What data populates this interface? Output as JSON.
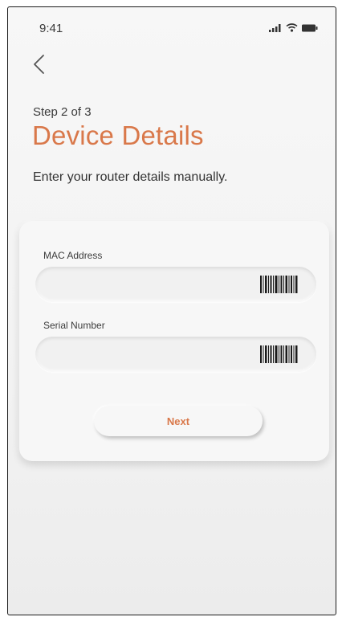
{
  "status_bar": {
    "time": "9:41"
  },
  "nav": {
    "back_icon": "chevron-left-icon"
  },
  "header": {
    "step": "Step 2 of 3",
    "title": "Device Details",
    "subtitle": "Enter your router details manually."
  },
  "form": {
    "mac": {
      "label": "MAC Address",
      "value": "",
      "scan_icon": "barcode-icon"
    },
    "serial": {
      "label": "Serial Number",
      "value": "",
      "scan_icon": "barcode-icon"
    },
    "next_label": "Next"
  },
  "colors": {
    "accent": "#d9784a",
    "background": "#f4f4f4",
    "text": "#333333"
  }
}
